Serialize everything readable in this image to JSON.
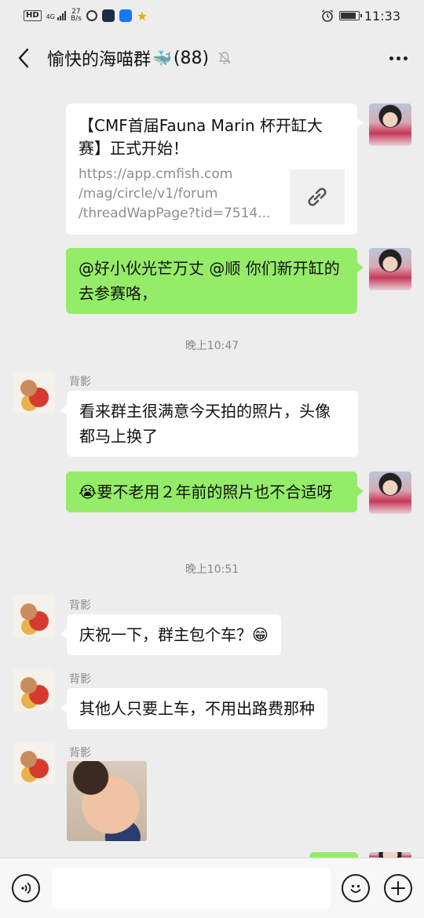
{
  "status_bar": {
    "hd": "HD",
    "network": "4G",
    "speed_value": "27",
    "speed_unit": "B/s",
    "time": "11:33",
    "battery_level": 0.9
  },
  "header": {
    "title": "愉快的海喵群",
    "title_emoji": "🐳",
    "member_count": "(88)"
  },
  "messages": [
    {
      "type": "link",
      "side": "right",
      "title": "【CMF首届Fauna Marin 杯开缸大赛】正式开始！",
      "url_lines": [
        "https://app.cmfish.com",
        "/mag/circle/v1/forum",
        "/threadWapPage?tid=7514..."
      ]
    },
    {
      "type": "text",
      "side": "right",
      "text": "@好小伙光芒万丈 @顺  你们新开缸的去参赛咯，"
    },
    {
      "type": "time",
      "text": "晚上10:47"
    },
    {
      "type": "text",
      "side": "left",
      "sender": "背影",
      "text": "看来群主很满意今天拍的照片，头像都马上换了"
    },
    {
      "type": "text",
      "side": "right",
      "emoji": "😭",
      "text": "要不老用２年前的照片也不合适呀"
    },
    {
      "type": "time",
      "text": "晚上10:51"
    },
    {
      "type": "text",
      "side": "left",
      "sender": "背影",
      "text": "庆祝一下，群主包个车？",
      "emoji": "😁"
    },
    {
      "type": "text",
      "side": "left",
      "sender": "背影",
      "text": "其他人只要上车，不用出路费那种"
    },
    {
      "type": "image",
      "side": "left",
      "sender": "背影"
    }
  ],
  "input": {
    "value": "",
    "placeholder": ""
  },
  "colors": {
    "background": "#ededed",
    "self_bubble": "#95ec69",
    "other_bubble": "#ffffff"
  }
}
